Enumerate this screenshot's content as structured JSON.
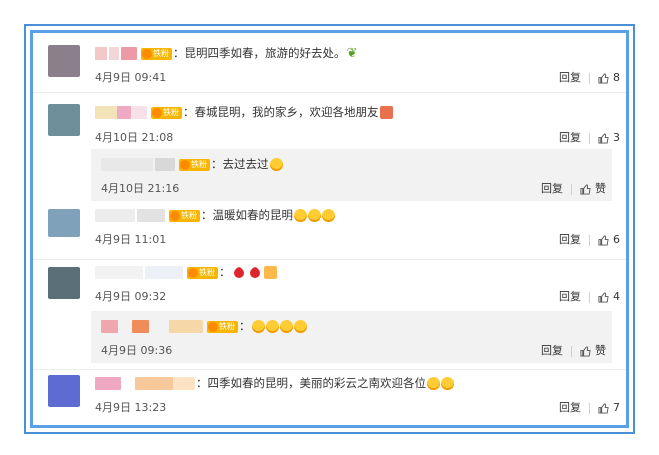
{
  "comments": [
    {
      "badge": "铁粉",
      "colon": "：",
      "text": "昆明四季如春，旅游的好去处。",
      "emoji": [
        "plant-emoji"
      ],
      "time": "4月9日 09:41",
      "reply": "回复",
      "likes": "8",
      "avatar_color": "#8a7f8b",
      "nick_colors": [
        "#f3c8c8",
        "#f2d6d6",
        "#ec9aa6"
      ]
    },
    {
      "badge": "铁粉",
      "colon": "：",
      "text": "春城昆明，我的家乡，欢迎各地朋友",
      "emoji": [
        "gift-emoji"
      ],
      "time": "4月10日 21:08",
      "reply": "回复",
      "likes": "3",
      "avatar_color": "#6f8f9a",
      "nick_colors": [
        "#f4e2b8",
        "#f0a9c2",
        "#f7e1e8"
      ]
    },
    {
      "badge": "铁粉",
      "colon": "：",
      "text": "去过去过",
      "emoji": [
        "laugh-emoji"
      ],
      "time": "4月10日 21:16",
      "reply": "回复",
      "likes": "赞",
      "nick_colors": [
        "#e8e8e8",
        "#d8d8d8"
      ]
    },
    {
      "badge": "铁粉",
      "colon": "：",
      "text": "温暖如春的昆明",
      "emoji": [
        "laugh-emoji",
        "laugh-emoji",
        "laugh-emoji"
      ],
      "time": "4月9日 11:01",
      "reply": "回复",
      "likes": "6",
      "avatar_color": "#7fa1b9",
      "nick_colors": [
        "#ededed",
        "#e2e2e2"
      ]
    },
    {
      "badge": "铁粉",
      "colon": "：",
      "text": "",
      "emoji": [
        "heart-emoji",
        "heart-emoji",
        "cheer-emoji"
      ],
      "time": "4月9日 09:32",
      "reply": "回复",
      "likes": "4",
      "avatar_color": "#5b6f78",
      "nick_colors": [
        "#f2f2f2",
        "#eef0f8"
      ]
    },
    {
      "badge": "铁粉",
      "colon": "：",
      "text": "",
      "emoji": [
        "cry-emoji",
        "cry-emoji",
        "cry-emoji",
        "cry-emoji"
      ],
      "time": "4月9日 09:36",
      "reply": "回复",
      "likes": "赞",
      "nick_colors": [
        "#f0a6ad",
        "#ef8c5a",
        "#f6d7a8"
      ]
    },
    {
      "badge": "",
      "colon": "：",
      "text": "四季如春的昆明，美丽的彩云之南欢迎各位",
      "emoji": [
        "laugh-emoji",
        "laugh-emoji"
      ],
      "time": "4月9日 13:23",
      "reply": "回复",
      "likes": "7",
      "avatar_color": "#5d6bd2",
      "nick_colors": [
        "#f0a8c2",
        "#f6c89a",
        "#fbe3c4"
      ]
    }
  ],
  "colors": {
    "frame": "#4a90d9",
    "inner_frame": "#5aa0e6",
    "badge": "#f7b500",
    "sub_bg": "#f2f2f2"
  }
}
